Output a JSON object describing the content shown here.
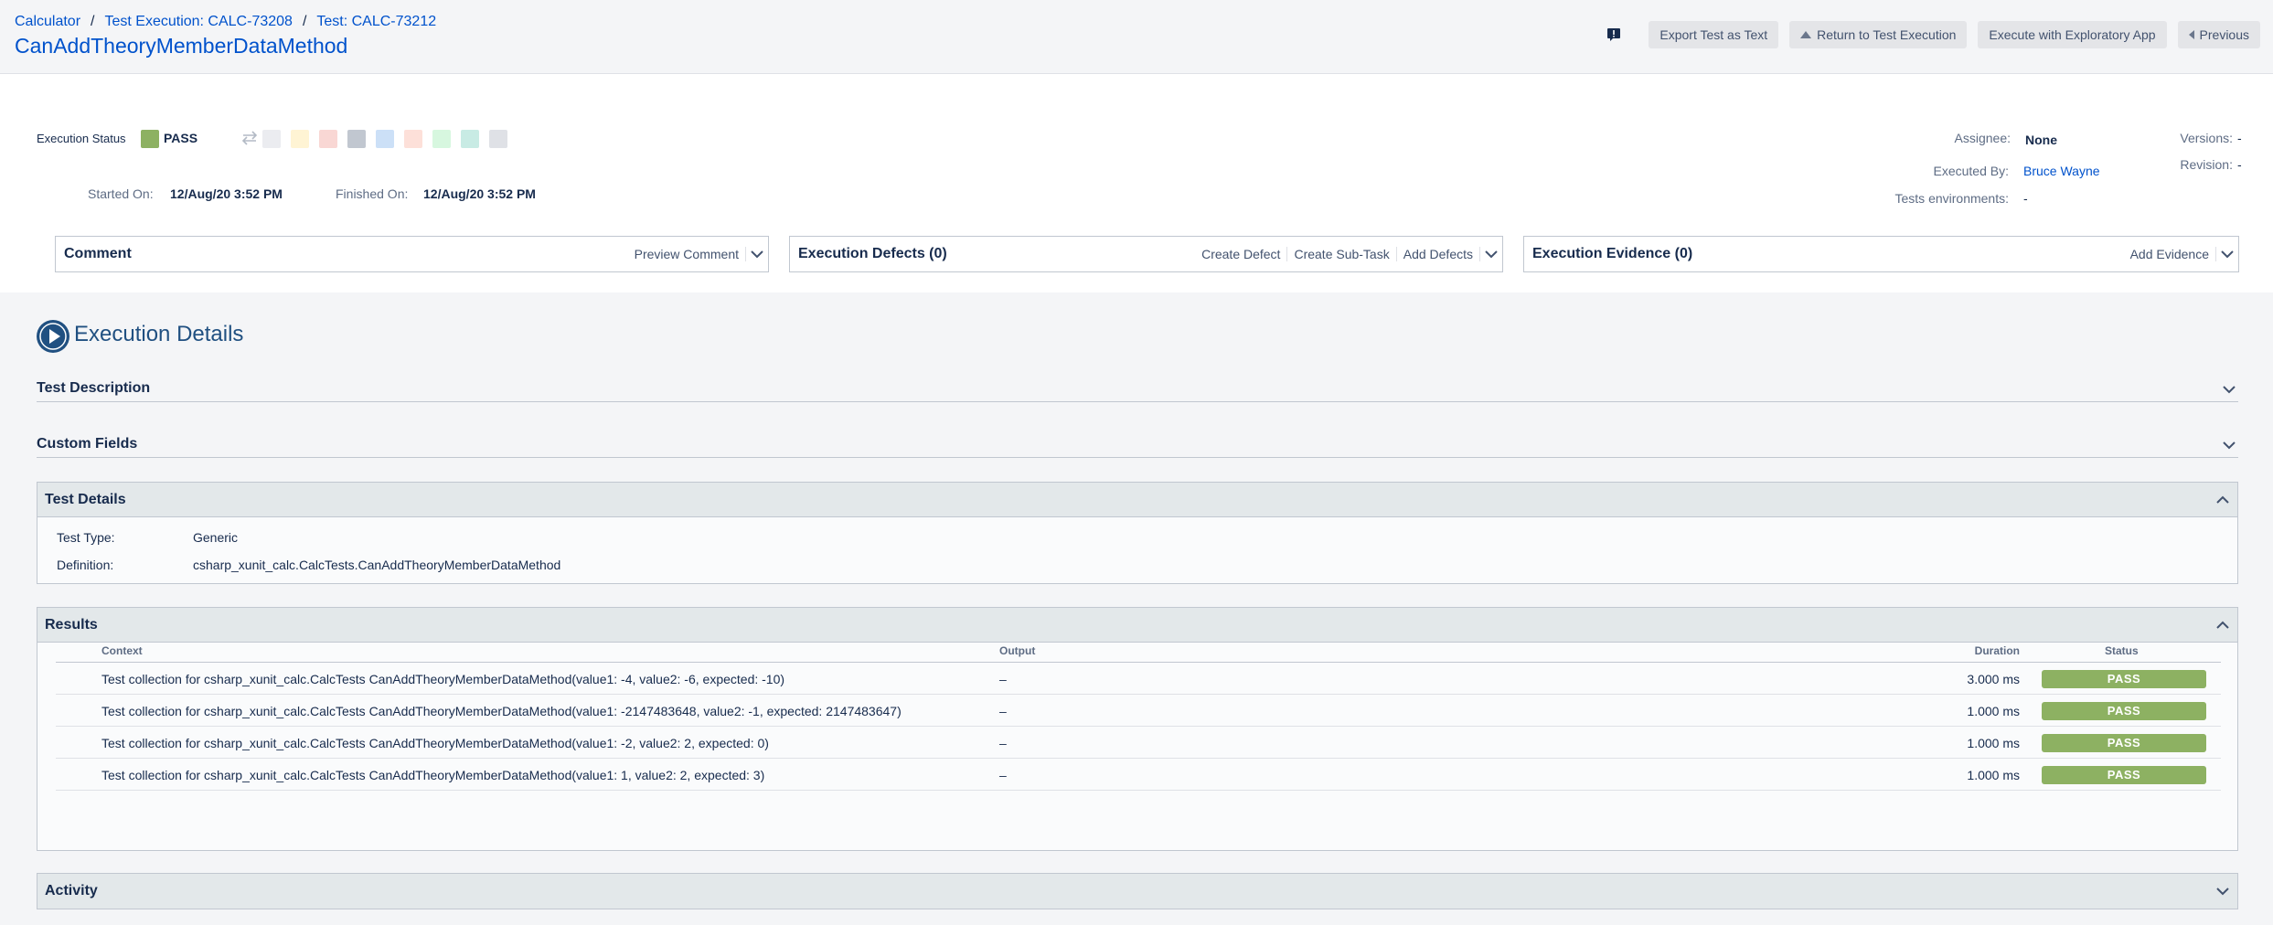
{
  "header": {
    "breadcrumb": [
      "Calculator",
      "Test Execution: CALC-73208",
      "Test: CALC-73212"
    ],
    "title": "CanAddTheoryMemberDataMethod",
    "actions": {
      "export": "Export Test as Text",
      "return": "Return to Test Execution",
      "exploratory": "Execute with Exploratory App",
      "previous": "Previous"
    }
  },
  "execution": {
    "status_label": "Execution Status",
    "status": "PASS",
    "status_color": "#8db162",
    "swatch_colors": [
      "#ebecf0",
      "#fff4d4",
      "#f9d7d4",
      "#c1c7d0",
      "#cce0f7",
      "#fde0d9",
      "#d7f7df",
      "#c8ebe4",
      "#dfe1e6"
    ],
    "started_label": "Started On:",
    "started": "12/Aug/20 3:52 PM",
    "finished_label": "Finished On:",
    "finished": "12/Aug/20 3:52 PM"
  },
  "meta": {
    "assignee_label": "Assignee:",
    "assignee": "None",
    "executed_by_label": "Executed By:",
    "executed_by": "Bruce Wayne",
    "environments_label": "Tests environments:",
    "environments": "-",
    "versions_label": "Versions:",
    "versions": "-",
    "revision_label": "Revision:",
    "revision": "-"
  },
  "panels": {
    "comment": {
      "title": "Comment",
      "action": "Preview Comment"
    },
    "defects": {
      "title": "Execution Defects (0)",
      "actions": [
        "Create Defect",
        "Create Sub-Task",
        "Add Defects"
      ]
    },
    "evidence": {
      "title": "Execution Evidence (0)",
      "action": "Add Evidence"
    }
  },
  "details": {
    "title": "Execution Details",
    "test_description": "Test Description",
    "custom_fields": "Custom Fields",
    "test_details": {
      "title": "Test Details",
      "type_label": "Test Type:",
      "type": "Generic",
      "definition_label": "Definition:",
      "definition": "csharp_xunit_calc.CalcTests.CanAddTheoryMemberDataMethod"
    },
    "results": {
      "title": "Results",
      "columns": {
        "context": "Context",
        "output": "Output",
        "duration": "Duration",
        "status": "Status"
      },
      "rows": [
        {
          "context": "Test collection for csharp_xunit_calc.CalcTests CanAddTheoryMemberDataMethod(value1: -4, value2: -6, expected: -10)",
          "output": "–",
          "duration": "3.000 ms",
          "status": "PASS"
        },
        {
          "context": "Test collection for csharp_xunit_calc.CalcTests CanAddTheoryMemberDataMethod(value1: -2147483648, value2: -1, expected: 2147483647)",
          "output": "–",
          "duration": "1.000 ms",
          "status": "PASS"
        },
        {
          "context": "Test collection for csharp_xunit_calc.CalcTests CanAddTheoryMemberDataMethod(value1: -2, value2: 2, expected: 0)",
          "output": "–",
          "duration": "1.000 ms",
          "status": "PASS"
        },
        {
          "context": "Test collection for csharp_xunit_calc.CalcTests CanAddTheoryMemberDataMethod(value1: 1, value2: 2, expected: 3)",
          "output": "–",
          "duration": "1.000 ms",
          "status": "PASS"
        }
      ]
    },
    "activity": "Activity"
  }
}
